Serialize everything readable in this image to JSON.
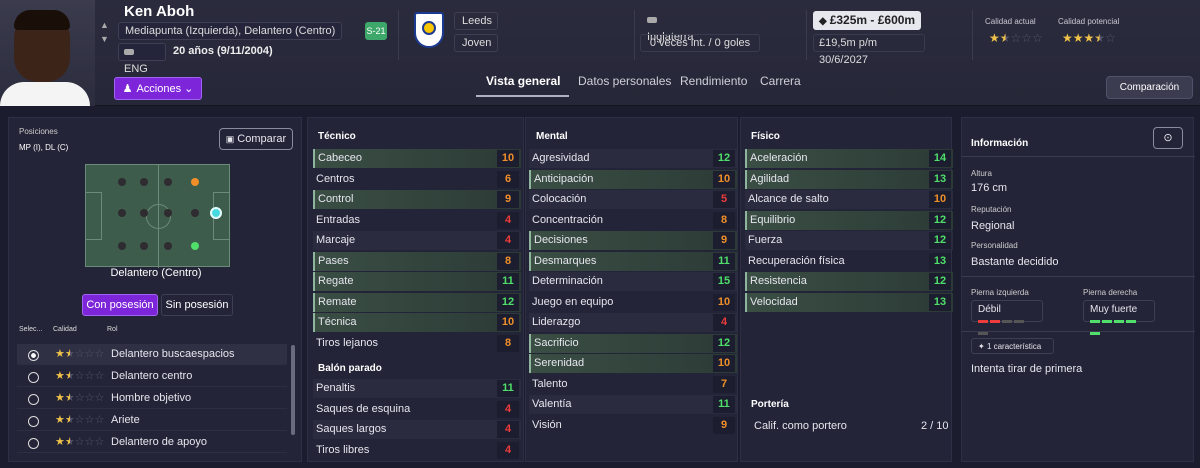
{
  "player": {
    "name": "Ken Aboh",
    "positions": "Mediapunta (Izquierda), Delantero (Centro)",
    "nationality": "ENG",
    "age": "20 años (9/11/2004)",
    "u21": "S-21"
  },
  "club": {
    "name": "Leeds",
    "status": "Joven"
  },
  "intl": {
    "country": "Inglaterra",
    "caps": "0 veces int. / 0 goles"
  },
  "contract": {
    "value": "£325m - £600m",
    "wage": "£19,5m p/m",
    "expiry": "30/6/2027"
  },
  "ability": {
    "current_label": "Calidad actual",
    "potential_label": "Calidad potencial",
    "current_stars": 1.5,
    "potential_stars": 3.5
  },
  "actions_label": "Acciones",
  "tabs": [
    "Vista general",
    "Datos personales",
    "Rendimiento",
    "Carrera"
  ],
  "compare_top": "Comparación",
  "left": {
    "positions_title": "Posiciones",
    "positions_value": "MP (I), DL (C)",
    "compare_btn": "Comparar",
    "selected_position": "Delantero (Centro)",
    "toggle_on": "Con posesión",
    "toggle_off": "Sin posesión",
    "hdr_sel": "Selec...",
    "hdr_qual": "Calidad",
    "hdr_role": "Rol",
    "roles": [
      {
        "name": "Delantero buscaespacios",
        "stars": 1.5,
        "selected": true
      },
      {
        "name": "Delantero centro",
        "stars": 1.5,
        "selected": false
      },
      {
        "name": "Hombre objetivo",
        "stars": 1.5,
        "selected": false
      },
      {
        "name": "Ariete",
        "stars": 1.5,
        "selected": false
      },
      {
        "name": "Delantero de apoyo",
        "stars": 1.5,
        "selected": false
      }
    ]
  },
  "tecnico": {
    "title": "Técnico",
    "items": [
      [
        "Cabeceo",
        10
      ],
      [
        "Centros",
        6
      ],
      [
        "Control",
        9
      ],
      [
        "Entradas",
        4
      ],
      [
        "Marcaje",
        4
      ],
      [
        "Pases",
        8
      ],
      [
        "Regate",
        11
      ],
      [
        "Remate",
        12
      ],
      [
        "Técnica",
        10
      ],
      [
        "Tiros lejanos",
        8
      ]
    ]
  },
  "balon": {
    "title": "Balón parado",
    "items": [
      [
        "Penaltis",
        11
      ],
      [
        "Saques de esquina",
        4
      ],
      [
        "Saques largos",
        4
      ],
      [
        "Tiros libres",
        4
      ]
    ]
  },
  "mental": {
    "title": "Mental",
    "items": [
      [
        "Agresividad",
        12
      ],
      [
        "Anticipación",
        10
      ],
      [
        "Colocación",
        5
      ],
      [
        "Concentración",
        8
      ],
      [
        "Decisiones",
        9
      ],
      [
        "Desmarques",
        11
      ],
      [
        "Determinación",
        15
      ],
      [
        "Juego en equipo",
        10
      ],
      [
        "Liderazgo",
        4
      ],
      [
        "Sacrificio",
        12
      ],
      [
        "Serenidad",
        10
      ],
      [
        "Talento",
        7
      ],
      [
        "Valentía",
        11
      ],
      [
        "Visión",
        9
      ]
    ]
  },
  "fisico": {
    "title": "Físico",
    "items": [
      [
        "Aceleración",
        14
      ],
      [
        "Agilidad",
        13
      ],
      [
        "Alcance de salto",
        10
      ],
      [
        "Equilibrio",
        12
      ],
      [
        "Fuerza",
        12
      ],
      [
        "Recuperación física",
        13
      ],
      [
        "Resistencia",
        12
      ],
      [
        "Velocidad",
        13
      ]
    ]
  },
  "porteria": {
    "title": "Portería",
    "label": "Calif. como portero",
    "value": "2 / 10"
  },
  "info": {
    "title": "Información",
    "height_label": "Altura",
    "height": "176 cm",
    "rep_label": "Reputación",
    "rep": "Regional",
    "pers_label": "Personalidad",
    "pers": "Bastante decidido",
    "lfoot_label": "Pierna izquierda",
    "lfoot": "Débil",
    "rfoot_label": "Pierna derecha",
    "rfoot": "Muy fuerte",
    "traits_btn": "1 característica",
    "trait": "Intenta tirar de primera"
  },
  "colors": {
    "accent": "#7d26d9",
    "green": "#4fdf6a",
    "orange": "#f08f2a",
    "red": "#ee3b3b",
    "star": "#f0c24a"
  }
}
